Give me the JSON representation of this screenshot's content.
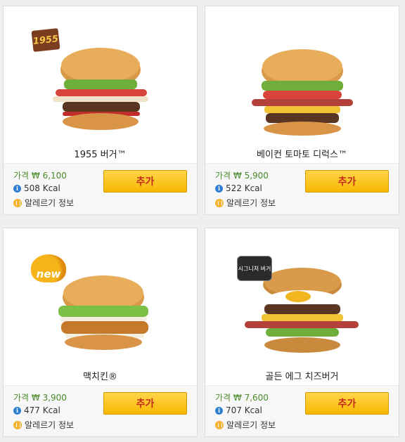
{
  "products": [
    {
      "name": "1955 버거™",
      "price": "가격 ₩ 6,100",
      "kcal": "508 Kcal",
      "allergy": "알레르기 정보",
      "add_label": "추가",
      "badge": "1955"
    },
    {
      "name": "베이컨 토마토 디럭스™",
      "price": "가격 ₩ 5,900",
      "kcal": "522 Kcal",
      "allergy": "알레르기 정보",
      "add_label": "추가"
    },
    {
      "name": "맥치킨®",
      "price": "가격 ₩ 3,900",
      "kcal": "477 Kcal",
      "allergy": "알레르기 정보",
      "add_label": "추가",
      "badge": "new"
    },
    {
      "name": "골든 에그 치즈버거",
      "price": "가격 ₩ 7,600",
      "kcal": "707 Kcal",
      "allergy": "알레르기 정보",
      "add_label": "추가",
      "badge": "시그니처 버거"
    }
  ],
  "icons": {
    "info": "info-icon",
    "allergy": "allergy-icon"
  },
  "colors": {
    "price": "#4a8a2a",
    "button_bg": "#ffc720",
    "button_text": "#c32b1c",
    "info_icon": "#2f7fd1",
    "allergy_icon": "#f4b431"
  }
}
